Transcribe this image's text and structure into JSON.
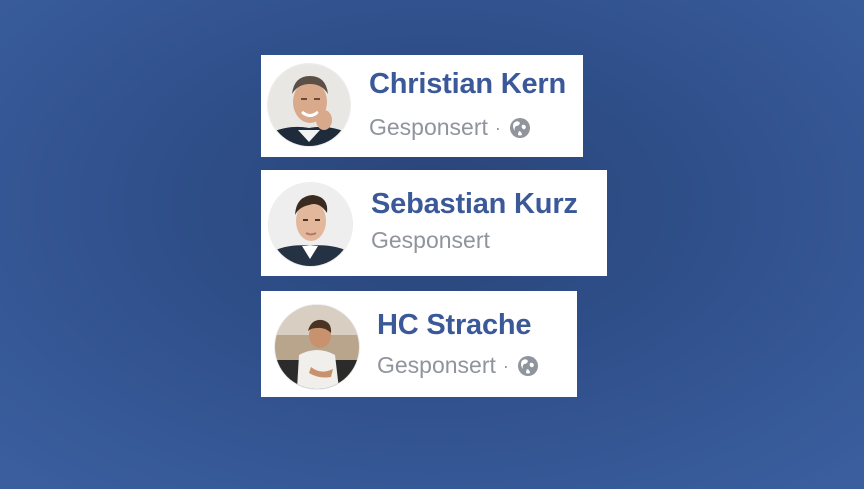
{
  "background_color": "#2f4f8a",
  "accent_name_color": "#3b5998",
  "meta_color": "#90949c",
  "posts": [
    {
      "name": "Christian Kern",
      "label": "Gesponsert",
      "separator": "·",
      "privacy_icon": "globe-icon",
      "avatar_icon": "profile-photo"
    },
    {
      "name": "Sebastian Kurz",
      "label": "Gesponsert",
      "avatar_icon": "profile-photo"
    },
    {
      "name": "HC Strache",
      "label": "Gesponsert",
      "separator": "·",
      "privacy_icon": "globe-icon",
      "avatar_icon": "profile-photo"
    }
  ]
}
